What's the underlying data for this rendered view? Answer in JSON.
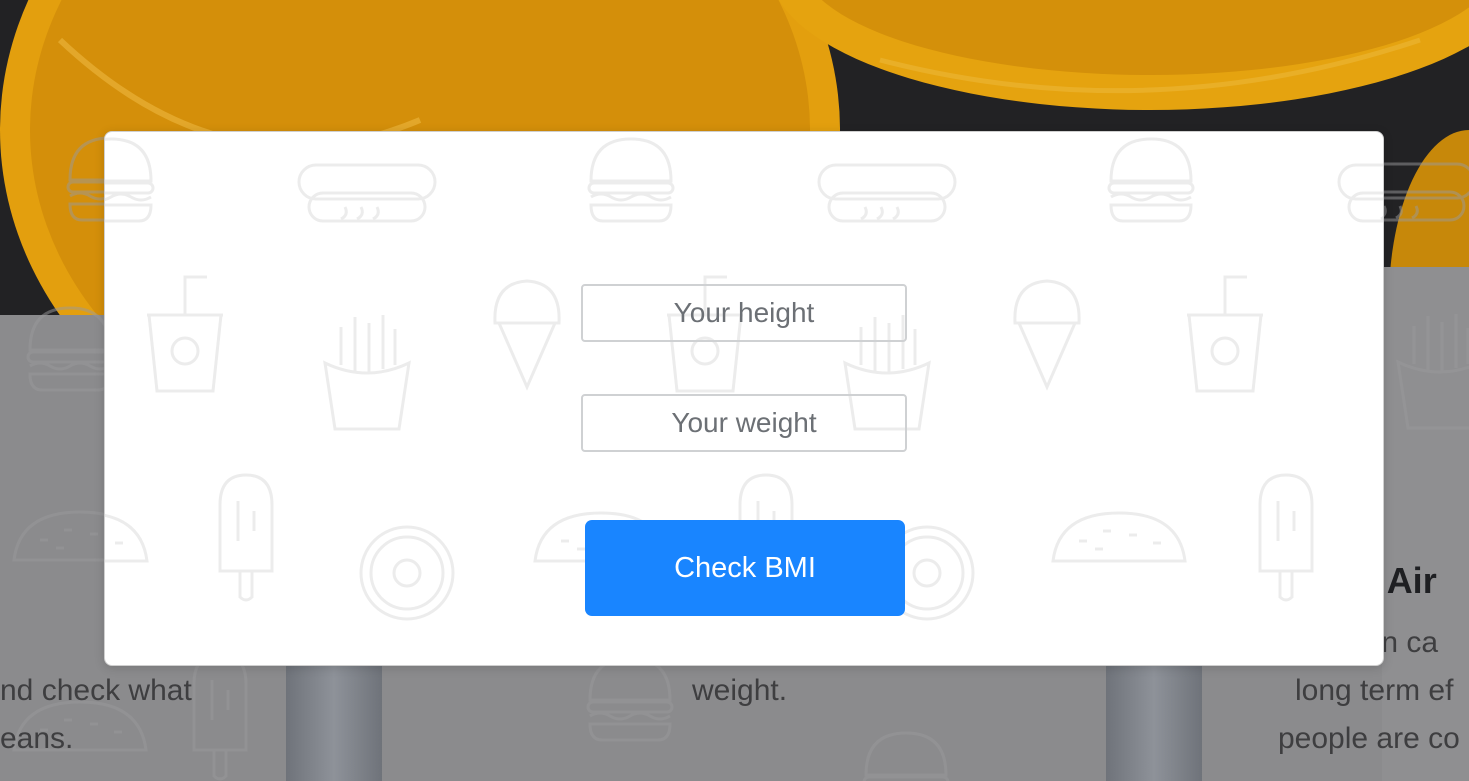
{
  "page": {
    "background_text": {
      "left_line1": "nd check what",
      "left_line2": "eans.",
      "center_line": "weight.",
      "right_title": "y Air",
      "right_line1": "ion ca",
      "right_line2": "long term ef",
      "right_line3": "people are co"
    }
  },
  "modal": {
    "height_input": {
      "value": "",
      "placeholder": "Your height"
    },
    "weight_input": {
      "value": "",
      "placeholder": "Your weight"
    },
    "submit_label": "Check BMI"
  },
  "colors": {
    "accent": "#1985ff",
    "modal_background": "#ffffff",
    "input_border": "#cfd1d3",
    "pattern_line": "#e6e6e6"
  },
  "icons": [
    "burger-icon",
    "hotdog-icon",
    "soda-cup-icon",
    "fries-icon",
    "ice-cream-cone-icon",
    "popsicle-icon",
    "taco-icon",
    "donut-icon"
  ]
}
